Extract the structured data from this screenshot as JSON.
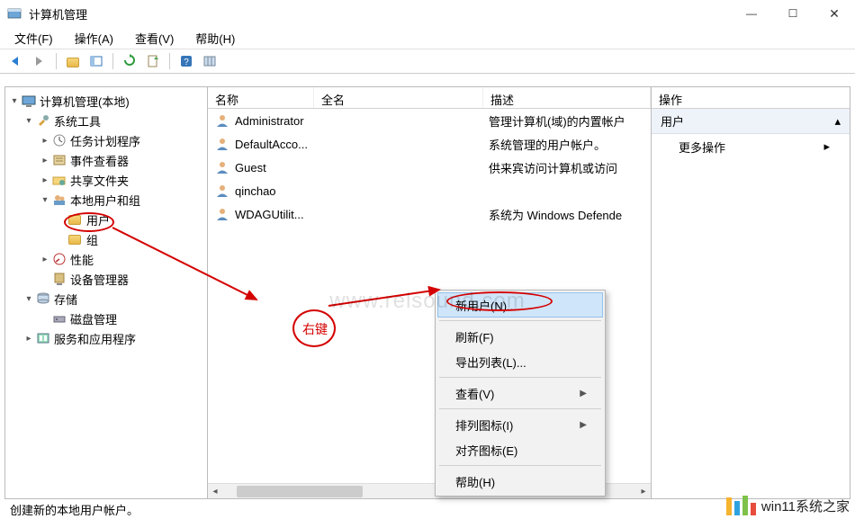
{
  "window": {
    "title": "计算机管理",
    "min_tip": "最小化",
    "max_tip": "最大化",
    "close_tip": "关闭"
  },
  "menubar": {
    "file": "文件(F)",
    "action": "操作(A)",
    "view": "查看(V)",
    "help": "帮助(H)"
  },
  "toolbar_icons": [
    "back",
    "forward",
    "up",
    "show-hide",
    "refresh",
    "export",
    "help",
    "columns"
  ],
  "tree": {
    "root": "计算机管理(本地)",
    "system_tools": "系统工具",
    "task_scheduler": "任务计划程序",
    "event_viewer": "事件查看器",
    "shared_folders": "共享文件夹",
    "local_users_groups": "本地用户和组",
    "users": "用户",
    "groups": "组",
    "performance": "性能",
    "device_manager": "设备管理器",
    "storage": "存储",
    "disk_mgmt": "磁盘管理",
    "services_apps": "服务和应用程序"
  },
  "columns": {
    "name": "名称",
    "fullname": "全名",
    "description": "描述"
  },
  "users": [
    {
      "name": "Administrator",
      "full": "",
      "desc": "管理计算机(域)的内置帐户"
    },
    {
      "name": "DefaultAcco...",
      "full": "",
      "desc": "系统管理的用户帐户。"
    },
    {
      "name": "Guest",
      "full": "",
      "desc": "供来宾访问计算机或访问"
    },
    {
      "name": "qinchao",
      "full": "",
      "desc": ""
    },
    {
      "name": "WDAGUtilit...",
      "full": "",
      "desc": "系统为 Windows Defende"
    }
  ],
  "actions_pane": {
    "header": "操作",
    "section": "用户",
    "more": "更多操作"
  },
  "context_menu": {
    "new_user": "新用户(N)...",
    "refresh": "刷新(F)",
    "export_list": "导出列表(L)...",
    "view": "查看(V)",
    "arrange_icons": "排列图标(I)",
    "align_icons": "对齐图标(E)",
    "help": "帮助(H)"
  },
  "statusbar": {
    "text": "创建新的本地用户帐户。"
  },
  "annotations": {
    "right_click": "右键"
  },
  "watermark": "www.relsound.com",
  "brand": "win11系统之家"
}
